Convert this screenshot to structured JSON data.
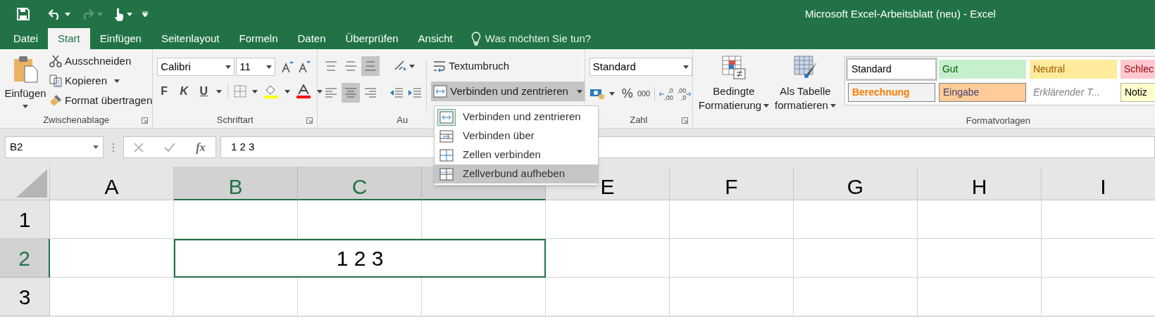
{
  "window": {
    "title": "Microsoft Excel-Arbeitsblatt (neu) - Excel"
  },
  "tabs": [
    {
      "label": "Datei",
      "selected": false
    },
    {
      "label": "Start",
      "selected": true
    },
    {
      "label": "Einfügen",
      "selected": false
    },
    {
      "label": "Seitenlayout",
      "selected": false
    },
    {
      "label": "Formeln",
      "selected": false
    },
    {
      "label": "Daten",
      "selected": false
    },
    {
      "label": "Überprüfen",
      "selected": false
    },
    {
      "label": "Ansicht",
      "selected": false
    }
  ],
  "tell_me": {
    "placeholder": "Was möchten Sie tun?"
  },
  "clipboard": {
    "label": "Zwischenablage",
    "paste": "Einfügen",
    "cut": "Ausschneiden",
    "copy": "Kopieren",
    "format_painter": "Format übertragen"
  },
  "font": {
    "label": "Schriftart",
    "font_name": "Calibri",
    "font_size": "11",
    "bold": "F",
    "italic": "K",
    "underline": "U"
  },
  "alignment": {
    "label": "Au",
    "wrap_text": "Textumbruch",
    "merge": "Verbinden und zentrieren",
    "merge_pressed": true,
    "vertical": [
      {
        "kind": "top",
        "selected": false
      },
      {
        "kind": "middle",
        "selected": false
      },
      {
        "kind": "bottom",
        "selected": true
      }
    ],
    "horizontal": [
      {
        "kind": "left",
        "selected": false
      },
      {
        "kind": "center",
        "selected": true
      },
      {
        "kind": "right",
        "selected": false
      }
    ]
  },
  "number": {
    "label": "Zahl",
    "format": "Standard",
    "percent": "%",
    "thousands": "000",
    "increase_decimal": [
      ",0",
      ",00"
    ],
    "decrease_decimal": [
      ",00",
      ",0"
    ]
  },
  "styles": {
    "label": "Formatvorlagen",
    "conditional": [
      "Bedingte",
      "Formatierung"
    ],
    "as_table": [
      "Als Tabelle",
      "formatieren"
    ],
    "gallery": [
      {
        "label": "Standard",
        "kind": "normal",
        "selected": true
      },
      {
        "label": "Gut",
        "kind": "good",
        "selected": false
      },
      {
        "label": "Neutral",
        "kind": "neutral",
        "selected": false
      },
      {
        "label": "Schlec",
        "kind": "bad",
        "selected": false
      },
      {
        "label": "Berechnung",
        "kind": "calculation",
        "selected": false
      },
      {
        "label": "Eingabe",
        "kind": "input",
        "selected": false
      },
      {
        "label": "Erklärender T...",
        "kind": "explanatory",
        "selected": false
      },
      {
        "label": "Notiz",
        "kind": "note",
        "selected": false
      }
    ]
  },
  "merge_menu": {
    "items": [
      {
        "label": "Verbinden und zentrieren",
        "kind": "merge_center",
        "current": true,
        "selected": false
      },
      {
        "label": "Verbinden über",
        "kind": "merge_across",
        "current": false,
        "selected": false
      },
      {
        "label": "Zellen verbinden",
        "kind": "merge_cells",
        "current": false,
        "selected": false
      },
      {
        "label": "Zellverbund aufheben",
        "kind": "unmerge",
        "current": false,
        "selected": true
      }
    ]
  },
  "name_box": {
    "value": "B2"
  },
  "formula_bar": {
    "fx": "fx",
    "value": "1 2 3"
  },
  "sheet": {
    "columns": [
      {
        "label": "A",
        "selected": false
      },
      {
        "label": "B",
        "selected": true
      },
      {
        "label": "C",
        "selected": true
      },
      {
        "selected": true
      },
      {
        "label": "E",
        "selected": false
      },
      {
        "label": "F",
        "selected": false
      },
      {
        "label": "G",
        "selected": false
      },
      {
        "label": "H",
        "selected": false
      },
      {
        "label": "I",
        "selected": false
      }
    ],
    "rows": [
      {
        "label": "1",
        "selected": false
      },
      {
        "label": "2",
        "selected": true,
        "merged_cell": {
          "value": "1 2 3",
          "selected": true
        }
      },
      {
        "label": "3",
        "selected": false
      }
    ]
  }
}
